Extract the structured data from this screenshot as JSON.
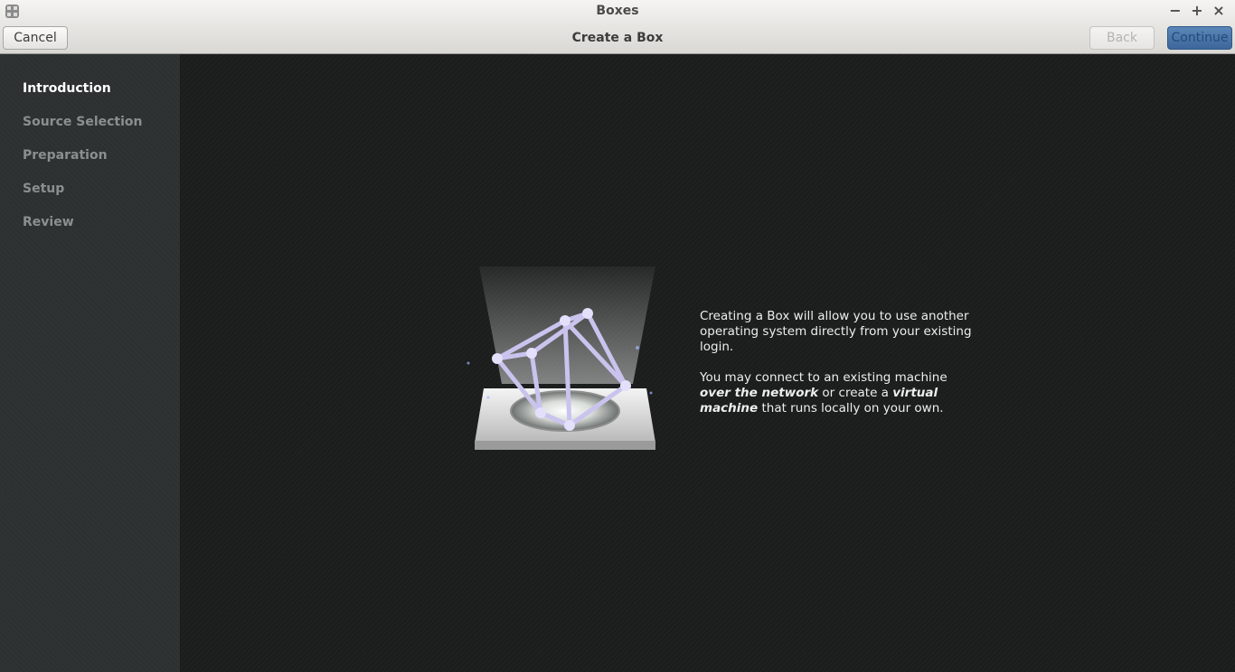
{
  "window": {
    "title": "Boxes",
    "controls": {
      "minimize": "−",
      "maximize": "+",
      "close": "×"
    }
  },
  "header": {
    "title": "Create a Box",
    "cancel_label": "Cancel",
    "back_label": "Back",
    "continue_label": "Continue"
  },
  "sidebar": {
    "steps": [
      {
        "label": "Introduction",
        "active": true
      },
      {
        "label": "Source Selection",
        "active": false
      },
      {
        "label": "Preparation",
        "active": false
      },
      {
        "label": "Setup",
        "active": false
      },
      {
        "label": "Review",
        "active": false
      }
    ]
  },
  "intro": {
    "para1": "Creating a Box will allow you to use another operating system directly from your existing login.",
    "para2_a": "You may connect to an existing machine ",
    "para2_b": "over the network",
    "para2_c": " or create a ",
    "para2_d": "virtual machine",
    "para2_e": " that runs locally on your own."
  },
  "colors": {
    "accent": "#4a76a8",
    "sidebar_bg": "#2d3131",
    "main_bg": "#1c1d1d"
  }
}
